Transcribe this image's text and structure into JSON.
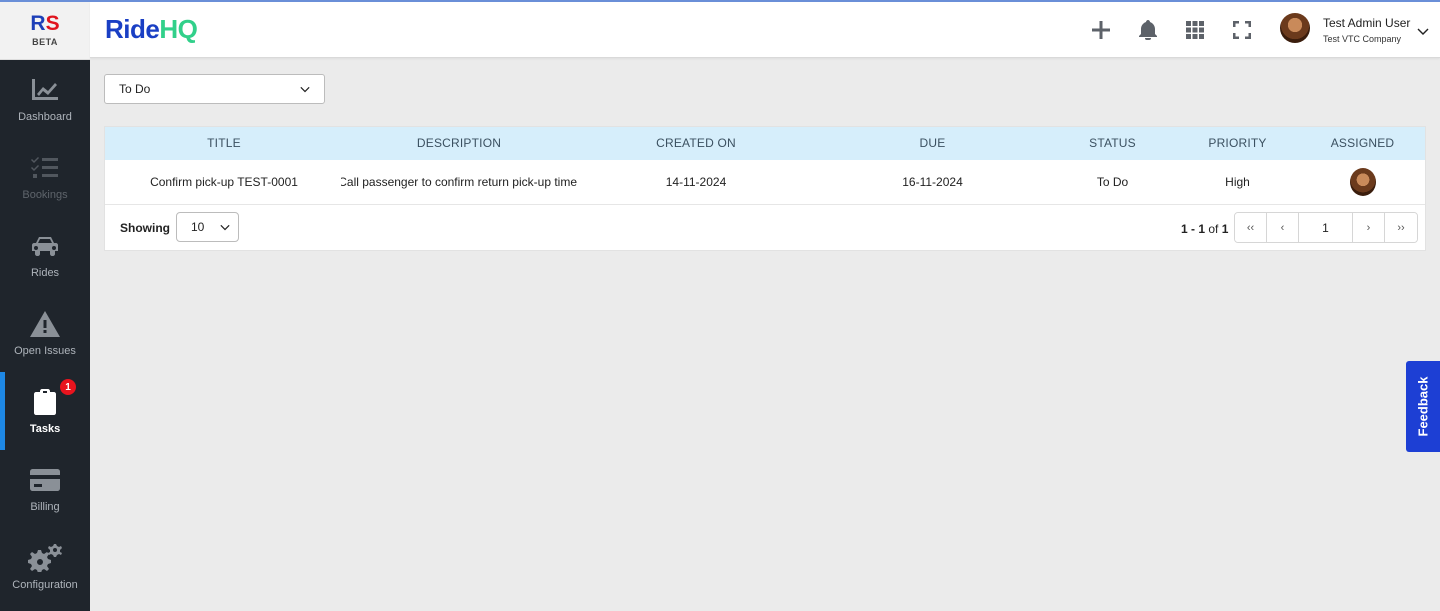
{
  "brand": {
    "logo_r": "R",
    "logo_s": "S",
    "beta": "BETA"
  },
  "sidebar": {
    "items": [
      {
        "label": "Dashboard",
        "icon": "chart-line-icon"
      },
      {
        "label": "Bookings",
        "icon": "list-check-icon",
        "disabled": true
      },
      {
        "label": "Rides",
        "icon": "car-icon"
      },
      {
        "label": "Open Issues",
        "icon": "warning-icon"
      },
      {
        "label": "Tasks",
        "icon": "clipboard-check-icon",
        "active": true,
        "badge": "1"
      },
      {
        "label": "Billing",
        "icon": "credit-card-icon"
      },
      {
        "label": "Configuration",
        "icon": "gears-icon"
      }
    ]
  },
  "header": {
    "title_part1": "Ride",
    "title_part2": "HQ",
    "user_name": "Test Admin User",
    "user_company": "Test VTC Company"
  },
  "filter": {
    "selected": "To Do"
  },
  "table": {
    "columns": [
      "TITLE",
      "DESCRIPTION",
      "CREATED ON",
      "DUE",
      "STATUS",
      "PRIORITY",
      "ASSIGNED"
    ],
    "rows": [
      {
        "title": "Confirm pick-up TEST-0001",
        "description": "Call passenger to confirm return pick-up time",
        "created_on": "14-11-2024",
        "due": "16-11-2024",
        "status": "To Do",
        "priority": "High"
      }
    ]
  },
  "footer": {
    "showing_label": "Showing",
    "page_size": "10",
    "range_bold": "1 - 1",
    "range_of": "of",
    "range_total": "1",
    "first": "‹‹",
    "prev": "‹",
    "page": "1",
    "next": "›",
    "last": "››"
  },
  "feedback": {
    "label": "Feedback"
  },
  "colors": {
    "accent": "#1e88e5",
    "brand_blue": "#1a3fc4",
    "brand_green": "#31d08a",
    "badge": "#e8141e",
    "feedback": "#1d3fd4",
    "table_header": "#d6eefb"
  }
}
